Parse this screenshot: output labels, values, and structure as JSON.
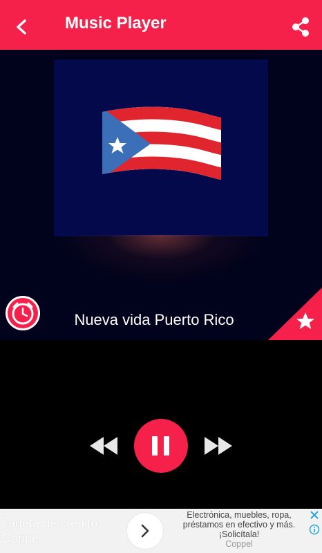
{
  "appbar": {
    "title": "Music Player",
    "back_icon": "arrow-back-icon",
    "share_icon": "share-icon",
    "color": "#f5214b"
  },
  "player": {
    "station_name": "Nueva vida Puerto Rico",
    "artwork": "puerto-rico-flag",
    "timer_icon": "alarm-clock-icon",
    "favorite_icon": "star-icon",
    "background": "#01021c"
  },
  "controls": {
    "rewind_icon": "rewind-icon",
    "pause_icon": "pause-icon",
    "forward_icon": "fast-forward-icon",
    "state": "playing"
  },
  "ad": {
    "headline_line1": "Tarjeta de crédito",
    "headline_line2": "Coppel",
    "body_line1": "Electrónica, muebles, ropa,",
    "body_line2": "préstamos en efectivo y más.",
    "body_line3": "¡Solicítala!",
    "source": "Coppel",
    "arrow_icon": "chevron-right-icon",
    "close_icon": "close-icon",
    "info_icon": "info-icon"
  }
}
